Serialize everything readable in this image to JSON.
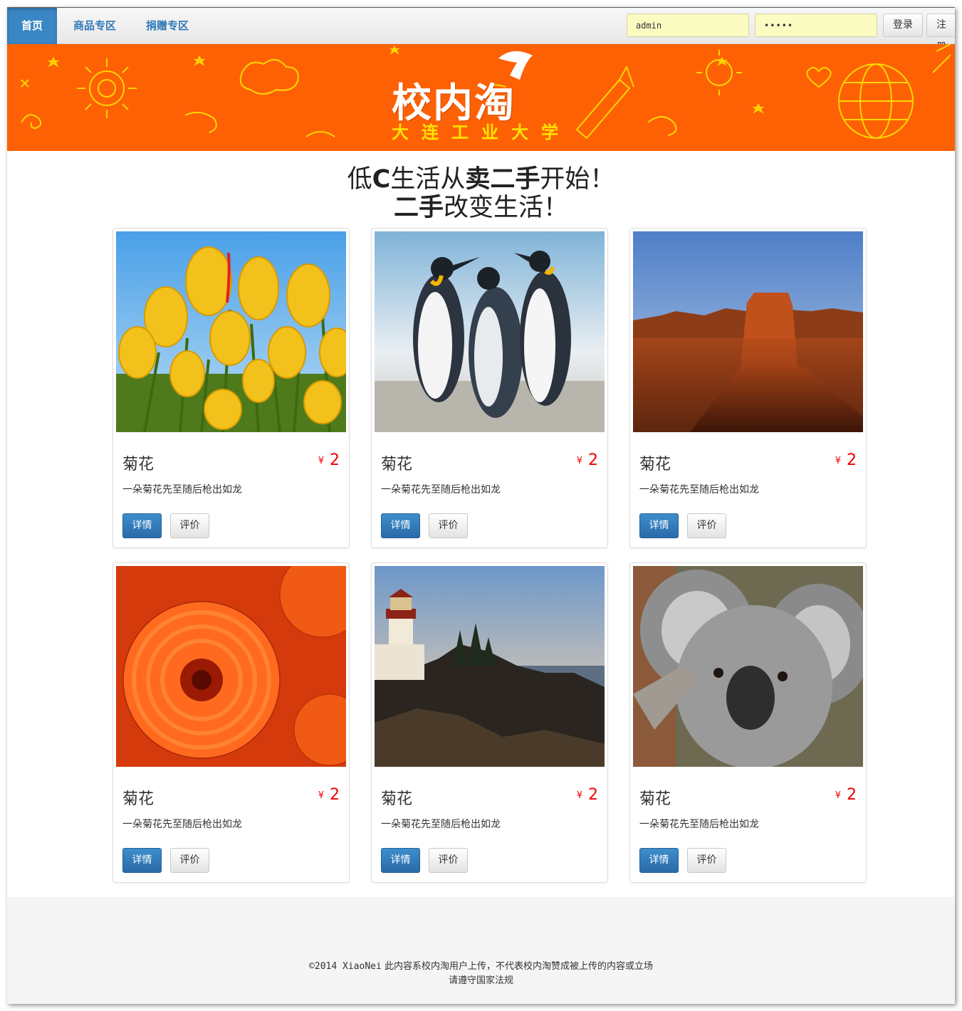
{
  "navbar": {
    "items": [
      {
        "label": "首页",
        "active": true
      },
      {
        "label": "商品专区",
        "active": false
      },
      {
        "label": "捐赠专区",
        "active": false
      }
    ],
    "username_value": "admin",
    "password_value": "•••••",
    "login_label": "登录",
    "register_label": "注册"
  },
  "banner": {
    "logo_text": "校内淘",
    "subtitle": "大连工业大学"
  },
  "slogan": {
    "line1_parts": [
      "低",
      "C",
      "生活从",
      "卖二手",
      "开始！"
    ],
    "line2_parts": [
      "二手",
      "改变生活！"
    ]
  },
  "products": [
    {
      "title": "菊花",
      "currency": "¥",
      "price": "2",
      "desc": "一朵菊花先至随后枪出如龙",
      "image": "yellow-tulips",
      "detail_label": "详情",
      "review_label": "评价"
    },
    {
      "title": "菊花",
      "currency": "¥",
      "price": "2",
      "desc": "一朵菊花先至随后枪出如龙",
      "image": "penguins",
      "detail_label": "详情",
      "review_label": "评价"
    },
    {
      "title": "菊花",
      "currency": "¥",
      "price": "2",
      "desc": "一朵菊花先至随后枪出如龙",
      "image": "desert-butte",
      "detail_label": "详情",
      "review_label": "评价"
    },
    {
      "title": "菊花",
      "currency": "¥",
      "price": "2",
      "desc": "一朵菊花先至随后枪出如龙",
      "image": "orange-chrysanthemum",
      "detail_label": "详情",
      "review_label": "评价"
    },
    {
      "title": "菊花",
      "currency": "¥",
      "price": "2",
      "desc": "一朵菊花先至随后枪出如龙",
      "image": "lighthouse",
      "detail_label": "详情",
      "review_label": "评价"
    },
    {
      "title": "菊花",
      "currency": "¥",
      "price": "2",
      "desc": "一朵菊花先至随后枪出如龙",
      "image": "koala",
      "detail_label": "详情",
      "review_label": "评价"
    }
  ],
  "footer": {
    "copyright": "©2014 XiaoNei",
    "line1": "此内容系校内淘用户上传，不代表校内淘赞成被上传的内容或立场",
    "line2": "请遵守国家法规"
  },
  "colors": {
    "nav_active": "#3b87c5",
    "link": "#2f78b8",
    "banner": "#fd6104",
    "banner_doodle": "#ffe400",
    "price": "#ee0000",
    "input_bg": "#fbfcc2"
  }
}
